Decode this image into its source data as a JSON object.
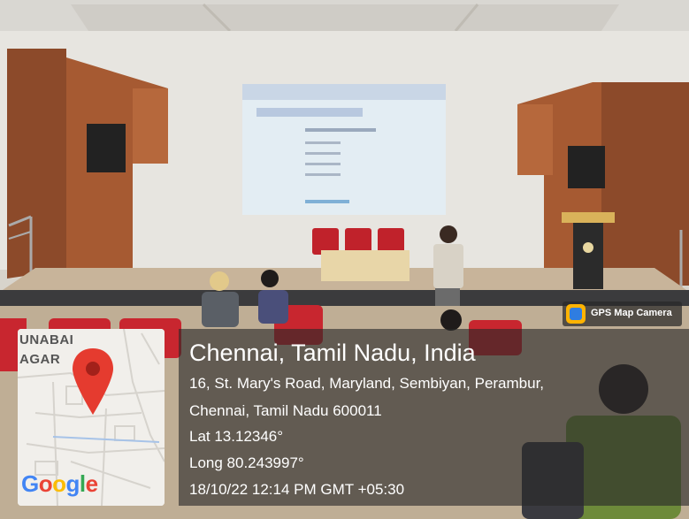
{
  "photo": {
    "scene": "auditorium-stage",
    "colors": {
      "wall": "#e6e4df",
      "wood": "#8c4a2a",
      "seat": "#c8262f",
      "screen": "#dfeaf1",
      "floor": "#b7a58c"
    }
  },
  "overlay": {
    "badge": {
      "icon": "gps-map-camera-icon",
      "label": "GPS Map Camera"
    },
    "map": {
      "label_line1": "UNABAI",
      "label_line2": "AGAR",
      "pin_icon": "location-pin-icon",
      "logo": "Google",
      "logo_colors": [
        "#4285F4",
        "#EA4335",
        "#FBBC05",
        "#4285F4",
        "#34A853",
        "#EA4335"
      ]
    },
    "location": {
      "city": "Chennai, Tamil Nadu, India",
      "address_line1": "16, St. Mary's Road, Maryland, Sembiyan, Perambur,",
      "address_line2": "Chennai, Tamil Nadu 600011",
      "lat": "Lat 13.12346°",
      "long": "Long 80.243997°",
      "datetime": "18/10/22 12:14 PM GMT +05:30"
    }
  }
}
